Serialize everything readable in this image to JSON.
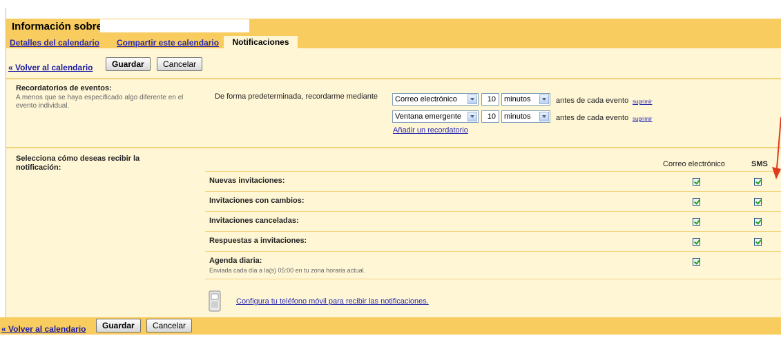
{
  "header": {
    "title": "Información sobre",
    "tabs": [
      {
        "label": "Detalles del calendario"
      },
      {
        "label": "Compartir este calendario"
      },
      {
        "label": "Notificaciones"
      }
    ]
  },
  "toolbar": {
    "back_label": "« Volver al calendario",
    "save_label": "Guardar",
    "cancel_label": "Cancelar"
  },
  "reminders": {
    "title": "Recordatorios de eventos:",
    "description": "A menos que se haya especificado algo diferente en el evento individual.",
    "default_label": "De forma predeterminada, recordarme mediante",
    "items": [
      {
        "method": "Correo electrónico",
        "amount": "10",
        "unit": "minutos",
        "suffix": "antes de cada evento",
        "remove": "suprimir"
      },
      {
        "method": "Ventana emergente",
        "amount": "10",
        "unit": "minutos",
        "suffix": "antes de cada evento",
        "remove": "suprimir"
      }
    ],
    "add_label": "Añadir un recordatorio"
  },
  "notifications": {
    "title": "Selecciona cómo deseas recibir la notificación:",
    "columns": [
      "Correo electrónico",
      "SMS"
    ],
    "rows": [
      {
        "label": "Nuevas invitaciones:",
        "email": true,
        "sms": true
      },
      {
        "label": "Invitaciones con cambios:",
        "email": true,
        "sms": true
      },
      {
        "label": "Invitaciones canceladas:",
        "email": true,
        "sms": true
      },
      {
        "label": "Respuestas a invitaciones:",
        "email": true,
        "sms": true
      },
      {
        "label": "Agenda diaria:",
        "sub": "Enviada cada día a la(s) 05:00 en tu zona horaria actual.",
        "email": true
      }
    ],
    "mobile_link": "Configura tu teléfono móvil para recibir las notificaciones."
  },
  "colors": {
    "header_bg": "#f8cc5e",
    "panel_bg": "#fff6d6",
    "link": "#2a2ab0",
    "annotation_arrow": "#e03a1e"
  },
  "icons": [
    "select-arrow-icon",
    "checkbox-checked-icon",
    "mobile-phone-icon",
    "annotation-arrow-icon"
  ]
}
